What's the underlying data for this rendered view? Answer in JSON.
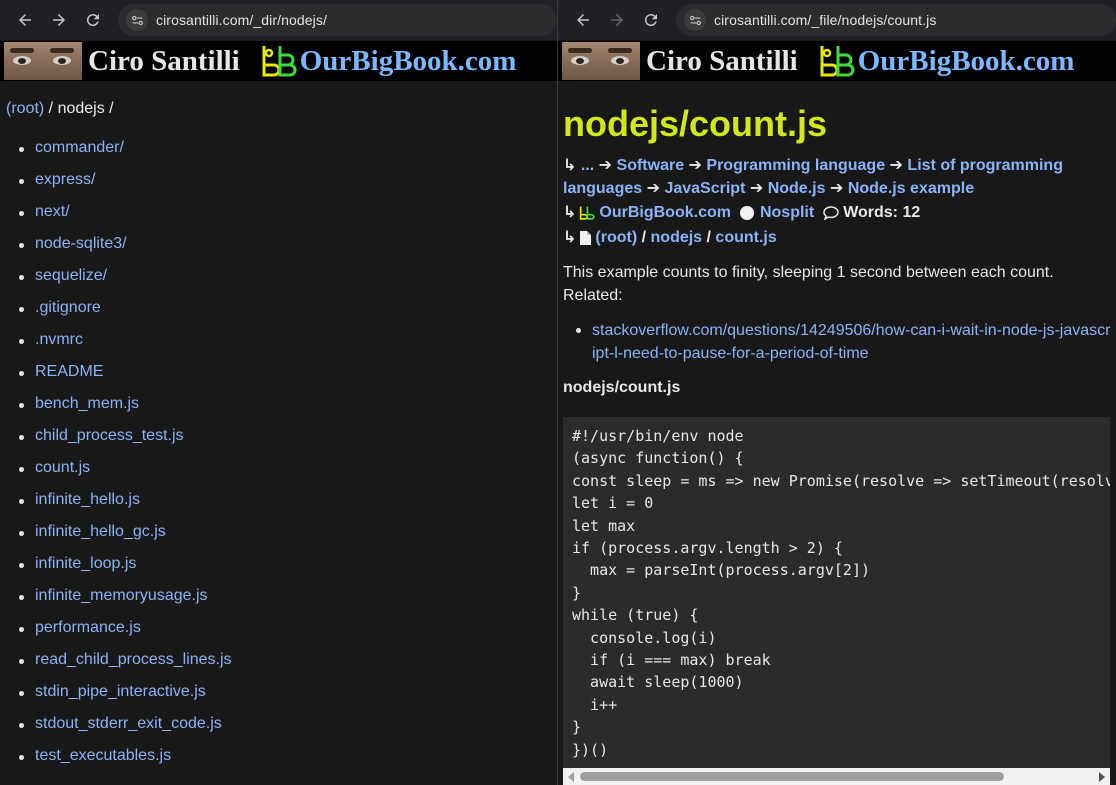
{
  "left": {
    "url": "cirosantilli.com/_dir/nodejs/",
    "banner": {
      "name": "Ciro Santilli",
      "site": "OurBigBook.com"
    },
    "breadcrumb": {
      "root": "(root)",
      "sep": " / ",
      "dir": "nodejs",
      "tail": " /"
    },
    "files": [
      "commander/",
      "express/",
      "next/",
      "node-sqlite3/",
      "sequelize/",
      ".gitignore",
      ".nvmrc",
      "README",
      "bench_mem.js",
      "child_process_test.js",
      "count.js",
      "infinite_hello.js",
      "infinite_hello_gc.js",
      "infinite_loop.js",
      "infinite_memoryusage.js",
      "performance.js",
      "read_child_process_lines.js",
      "stdin_pipe_interactive.js",
      "stdout_stderr_exit_code.js",
      "test_executables.js"
    ]
  },
  "right": {
    "url": "cirosantilli.com/_file/nodejs/count.js",
    "banner": {
      "name": "Ciro Santilli",
      "site": "OurBigBook.com"
    },
    "title": "nodejs/count.js",
    "ancestors": {
      "start": "↳ ",
      "ellipsis": "...",
      "arrow": " ➔",
      "items": [
        "Software",
        "Programming language",
        "List of programming languages",
        "JavaScript",
        "Node.js",
        "Node.js example"
      ]
    },
    "meta": {
      "arrow": "↳",
      "site": "OurBigBook.com",
      "nosplit": "Nosplit",
      "words": "Words: 12"
    },
    "path": {
      "arrow": "↳",
      "root": "(root)",
      "dir": "nodejs",
      "file": "count.js",
      "sep": " / "
    },
    "paragraph": "This example counts to finity, sleeping 1 second between each count. Related:",
    "related_links": [
      "stackoverflow.com/questions/14249506/how-can-i-wait-in-node-js-javascript-l-need-to-pause-for-a-period-of-time"
    ],
    "code_title": "nodejs/count.js",
    "code": "#!/usr/bin/env node\n(async function() {\nconst sleep = ms => new Promise(resolve => setTimeout(resolve, ms))\nlet i = 0\nlet max\nif (process.argv.length > 2) {\n  max = parseInt(process.argv[2])\n}\nwhile (true) {\n  console.log(i)\n  if (i === max) break\n  await sleep(1000)\n  i++\n}\n})()"
  },
  "colors": {
    "link": "#8ab4f8",
    "title": "#d3e81a",
    "background": "#181818",
    "code_bg": "#2b2b2b"
  },
  "icons": [
    "back-arrow-icon",
    "forward-arrow-icon",
    "reload-icon",
    "site-info-icon",
    "ourbigbook-logo-icon",
    "nosplit-circle-icon",
    "speech-bubble-icon",
    "document-icon"
  ]
}
